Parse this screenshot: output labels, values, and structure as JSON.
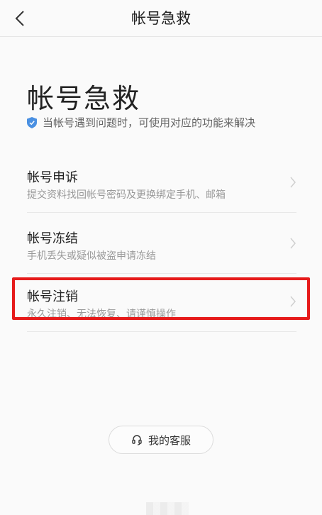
{
  "nav": {
    "title": "帐号急救"
  },
  "hero": {
    "title": "帐号急救",
    "subtitle": "当帐号遇到问题时，可使用对应的功能来解决"
  },
  "items": [
    {
      "title": "帐号申诉",
      "desc": "提交资料找回帐号密码及更换绑定手机、邮箱"
    },
    {
      "title": "帐号冻结",
      "desc": "手机丢失或疑似被盗申请冻结"
    },
    {
      "title": "帐号注销",
      "desc": "永久注销、无法恢复、请谨慎操作"
    }
  ],
  "service_button": {
    "label": "我的客服"
  },
  "colors": {
    "highlight": "#e61b1b",
    "shield": "#4a90e2"
  },
  "icons": [
    "back-icon",
    "shield-icon",
    "chevron-right-icon",
    "headset-icon"
  ]
}
